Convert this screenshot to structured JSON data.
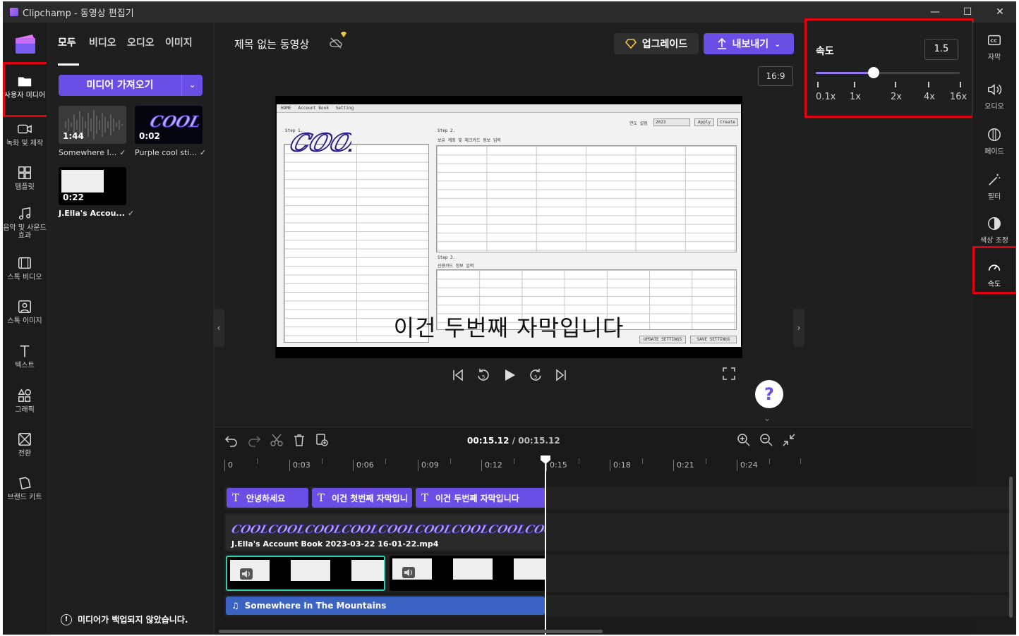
{
  "window": {
    "title": "Clipchamp - 동영상 편집기",
    "min": "—",
    "max": "☐",
    "close": "✕"
  },
  "rail": {
    "items": [
      {
        "label": "사용자 미디어",
        "icon": "folder-icon"
      },
      {
        "label": "녹화 및 제작",
        "icon": "video-camera-icon"
      },
      {
        "label": "템플릿",
        "icon": "templates-icon"
      },
      {
        "label": "음악 및 사운드 효과",
        "icon": "music-note-icon"
      },
      {
        "label": "스톡 비디오",
        "icon": "film-icon"
      },
      {
        "label": "스톡 이미지",
        "icon": "image-icon"
      },
      {
        "label": "텍스트",
        "icon": "text-icon"
      },
      {
        "label": "그래픽",
        "icon": "shapes-icon"
      },
      {
        "label": "전환",
        "icon": "transition-icon"
      },
      {
        "label": "브랜드 키트",
        "icon": "brand-kit-icon"
      }
    ]
  },
  "panel": {
    "tabs": [
      "모두",
      "비디오",
      "오디오",
      "이미지"
    ],
    "import_label": "미디어 가져오기",
    "media": [
      {
        "duration": "1:44",
        "label": "Somewhere I..."
      },
      {
        "duration": "0:02",
        "label": "Purple cool sti..."
      },
      {
        "duration": "0:22",
        "label": "J.Ella's Accou..."
      }
    ],
    "backup_text": "미디어가 백업되지 않았습니다."
  },
  "header": {
    "project_title": "제목 없는 동영상",
    "upgrade_label": "업그레이드",
    "export_label": "내보내기",
    "aspect_ratio": "16:9"
  },
  "preview": {
    "subtitle": "이건 두번째 자막입니다",
    "screen": {
      "menu": [
        "HOME",
        "Account Book",
        "Setting"
      ],
      "step1": "Step 1.",
      "step2": "Step 2.",
      "step2_desc": "보유 계좌 및 체크카드 정보 입력",
      "step3": "Step 3.",
      "step3_desc": "신용카드 정보 입력",
      "year_label": "연도 설정",
      "year_value": "2023",
      "apply": "Apply",
      "create": "Create",
      "update_btn": "UPDATE SETTINGS",
      "save_btn": "SAVE SETTINGS",
      "cool_text": "COOL"
    }
  },
  "speed": {
    "title": "속도",
    "value": "1.5",
    "ticks": [
      "0.1x",
      "1x",
      "2x",
      "4x",
      "16x"
    ],
    "slider_fraction": 0.4
  },
  "right_rail": {
    "items": [
      {
        "label": "자막",
        "icon": "captions-icon"
      },
      {
        "label": "오디오",
        "icon": "speaker-icon"
      },
      {
        "label": "페이드",
        "icon": "fade-icon"
      },
      {
        "label": "필터",
        "icon": "magic-wand-icon"
      },
      {
        "label": "색상 조정",
        "icon": "color-adjust-icon"
      },
      {
        "label": "속도",
        "icon": "speedometer-icon"
      }
    ]
  },
  "timeline": {
    "current_time": "00:15.12",
    "separator": " / ",
    "total_time": "00:15.12",
    "ruler": [
      "0",
      "0:03",
      "0:06",
      "0:09",
      "0:12",
      "0:15",
      "0:18",
      "0:21",
      "0:24"
    ],
    "text_clips": [
      "안녕하세요",
      "이건 첫번째 자막입니",
      "이건 두번째 자막입니다"
    ],
    "video_clip_name": "J.Ella's Account Book 2023-03-22 16-01-22.mp4",
    "audio_clip_name": "Somewhere In The Mountains"
  },
  "colors": {
    "accent": "#6b4ee6",
    "highlight": "#e3000f",
    "selection": "#2bd1b0",
    "audio": "#3b63c4"
  }
}
